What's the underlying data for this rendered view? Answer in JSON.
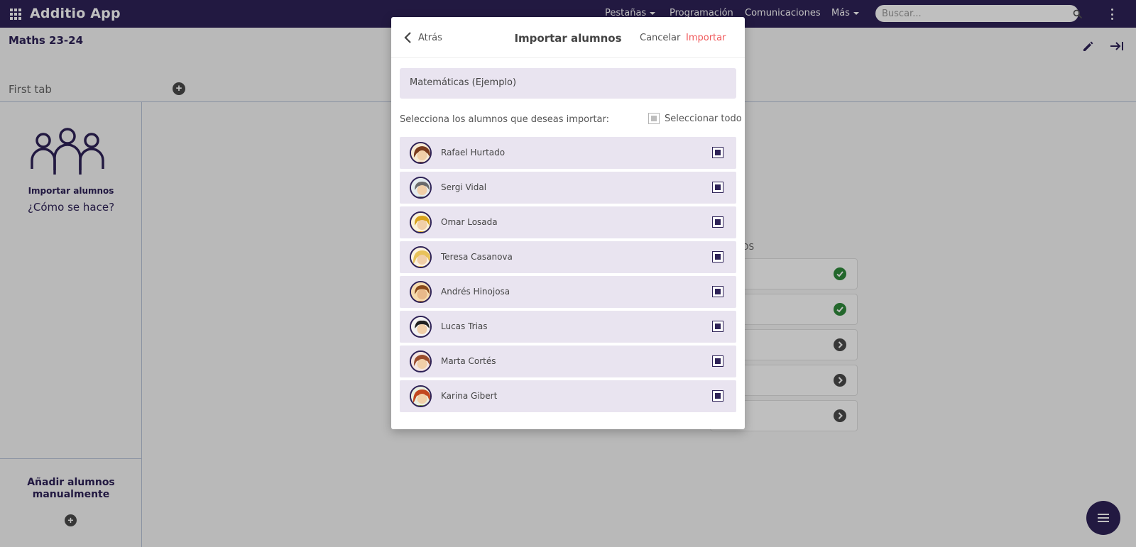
{
  "app": {
    "title": "Additio App"
  },
  "nav": {
    "items": [
      {
        "label": "Pestañas"
      },
      {
        "label": "Programación"
      },
      {
        "label": "Comunicaciones"
      },
      {
        "label": "Más"
      }
    ],
    "search_placeholder": "Buscar..."
  },
  "page": {
    "title": "Maths 23-24",
    "tab": "First tab",
    "caption_fragment": "OS"
  },
  "sidebar": {
    "import_label": "Importar alumnos",
    "howto_link": "¿Cómo se hace?",
    "add_manual_label": "Añadir alumnos manualmente"
  },
  "steps": {
    "statuses": [
      "done",
      "done",
      "pending",
      "pending",
      "pending"
    ]
  },
  "modal": {
    "back_label": "Atrás",
    "title": "Importar alumnos",
    "cancel_label": "Cancelar",
    "import_label": "Importar",
    "class_name": "Matemáticas (Ejemplo)",
    "instruction": "Selecciona los alumnos que deseas importar:",
    "select_all_label": "Seleccionar todo",
    "select_all_state": "indeterminate",
    "students": [
      {
        "name": "Rafael Hurtado",
        "checked": true,
        "avatar_hair": "#7a3b1d"
      },
      {
        "name": "Sergi Vidal",
        "checked": true,
        "avatar_hair": "#6b6b6b"
      },
      {
        "name": "Omar Losada",
        "checked": true,
        "avatar_hair": "#d8a21c"
      },
      {
        "name": "Teresa Casanova",
        "checked": true,
        "avatar_hair": "#e8c25a"
      },
      {
        "name": "Andrés Hinojosa",
        "checked": true,
        "avatar_hair": "#8a4a1b"
      },
      {
        "name": "Lucas Trias",
        "checked": true,
        "avatar_hair": "#222222"
      },
      {
        "name": "Marta Cortés",
        "checked": true,
        "avatar_hair": "#9b4d2d"
      },
      {
        "name": "Karina Gibert",
        "checked": true,
        "avatar_hair": "#c2461f"
      }
    ]
  },
  "colors": {
    "brand": "#2e2257",
    "accent": "#f0585a",
    "row_bg": "#e9e4f0",
    "status_done": "#2f8a3b"
  }
}
